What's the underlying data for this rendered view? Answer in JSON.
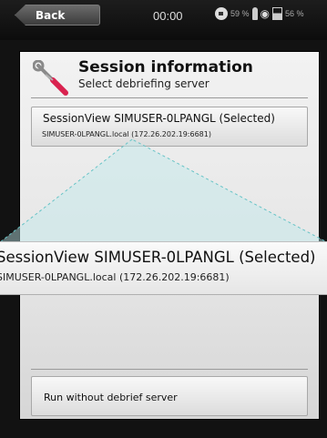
{
  "statusbar": {
    "back_label": "Back",
    "time": "00:00",
    "indicator_1": "59 %",
    "indicator_2": "56 %"
  },
  "header": {
    "title": "Session information",
    "subtitle": "Select debriefing server"
  },
  "servers": [
    {
      "name": "SessionView SIMUSER-0LPANGL (Selected)",
      "address": "SIMUSER-0LPANGL.local (172.26.202.19:6681)"
    }
  ],
  "zoom_callout": {
    "name": "SessionView SIMUSER-0LPANGL (Selected)",
    "address": "SIMUSER-0LPANGL.local (172.26.202.19:6681)"
  },
  "actions": {
    "run_without_server": "Run without debrief server"
  }
}
